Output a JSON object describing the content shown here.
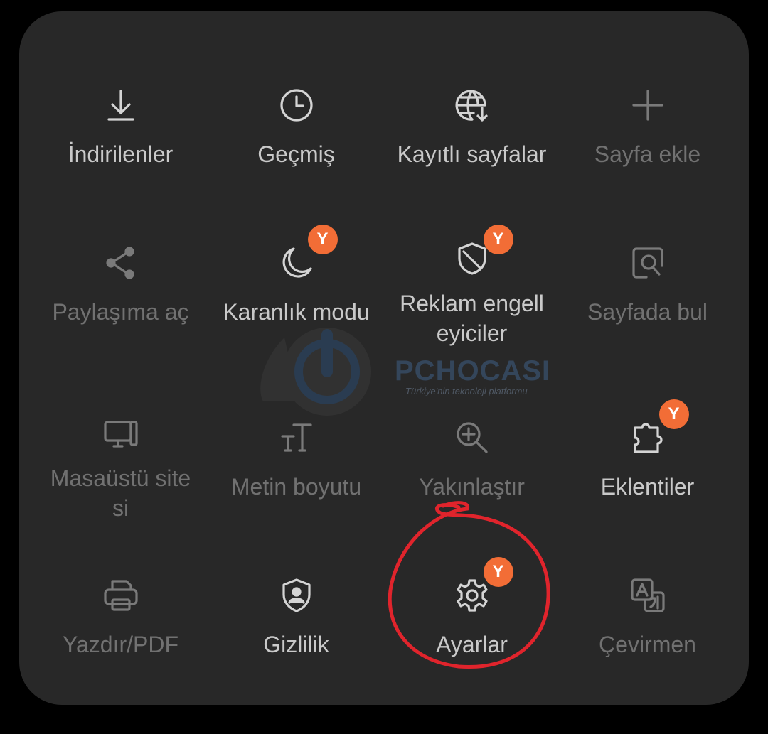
{
  "colors": {
    "badge": "#f26d36",
    "annotation": "#e0242c",
    "panel": "#282828",
    "text_active": "#c9c9c9",
    "text_dim": "#717171"
  },
  "menu": {
    "items": [
      {
        "label": "İndirilenler",
        "icon": "download-icon"
      },
      {
        "label": "Geçmiş",
        "icon": "clock-icon"
      },
      {
        "label": "Kayıtlı sayfalar",
        "icon": "globe-download-icon"
      },
      {
        "label": "Sayfa ekle",
        "icon": "plus-icon"
      },
      {
        "label": "Paylaşıma aç",
        "icon": "share-icon"
      },
      {
        "label": "Karanlık modu",
        "icon": "moon-icon",
        "badge": "Y"
      },
      {
        "label": "Reklam engelleyiciler",
        "icon": "shield-block-icon",
        "badge": "Y"
      },
      {
        "label": "Sayfada bul",
        "icon": "find-in-page-icon"
      },
      {
        "label": "Masaüstü sitesi",
        "icon": "desktop-icon"
      },
      {
        "label": "Metin boyutu",
        "icon": "text-size-icon"
      },
      {
        "label": "Yakınlaştır",
        "icon": "zoom-in-icon"
      },
      {
        "label": "Eklentiler",
        "icon": "puzzle-icon",
        "badge": "Y"
      },
      {
        "label": "Yazdır/PDF",
        "icon": "printer-icon"
      },
      {
        "label": "Gizlilik",
        "icon": "privacy-shield-icon"
      },
      {
        "label": "Ayarlar",
        "icon": "gear-icon",
        "badge": "Y"
      },
      {
        "label": "Çevirmen",
        "icon": "translate-icon"
      }
    ]
  },
  "watermark": {
    "brand": "PCHOCASI",
    "tagline": "Türkiye'nin teknoloji platformu"
  }
}
